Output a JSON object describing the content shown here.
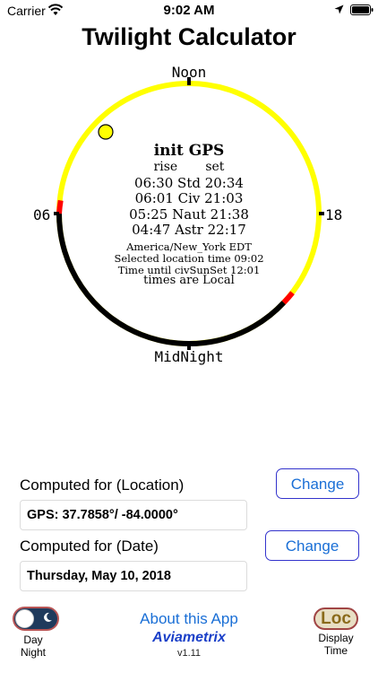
{
  "status": {
    "carrier": "Carrier",
    "time": "9:02 AM"
  },
  "app": {
    "title": "Twilight Calculator"
  },
  "dial": {
    "noon": "Noon",
    "midnight": "MidNight",
    "left": "06",
    "right": "18",
    "heading": "init GPS",
    "columns": "rise       set",
    "rows": [
      "06:30 Std 20:34",
      "06:01 Civ 21:03",
      "05:25 Naut 21:38",
      "04:47 Astr 22:17"
    ],
    "timezone": "America/New_York EDT",
    "selected_time": "Selected location time 09:02",
    "time_until": "Time until civSunSet 12:01",
    "times_mode": "times are Local",
    "colors": {
      "day": "#ffff00",
      "twilight": "#ff0000",
      "night": "#000000"
    }
  },
  "location": {
    "label": "Computed for (Location)",
    "value": "GPS: 37.7858°/ -84.0000°",
    "change": "Change"
  },
  "date": {
    "label": "Computed for (Date)",
    "value": "Thursday, May 10, 2018",
    "change": "Change"
  },
  "footer": {
    "day": "Day",
    "night": "Night",
    "about": "About this App",
    "brand": "Aviametrix",
    "version": "v1.11",
    "loc": "Loc",
    "display": "Display",
    "time": "Time"
  }
}
